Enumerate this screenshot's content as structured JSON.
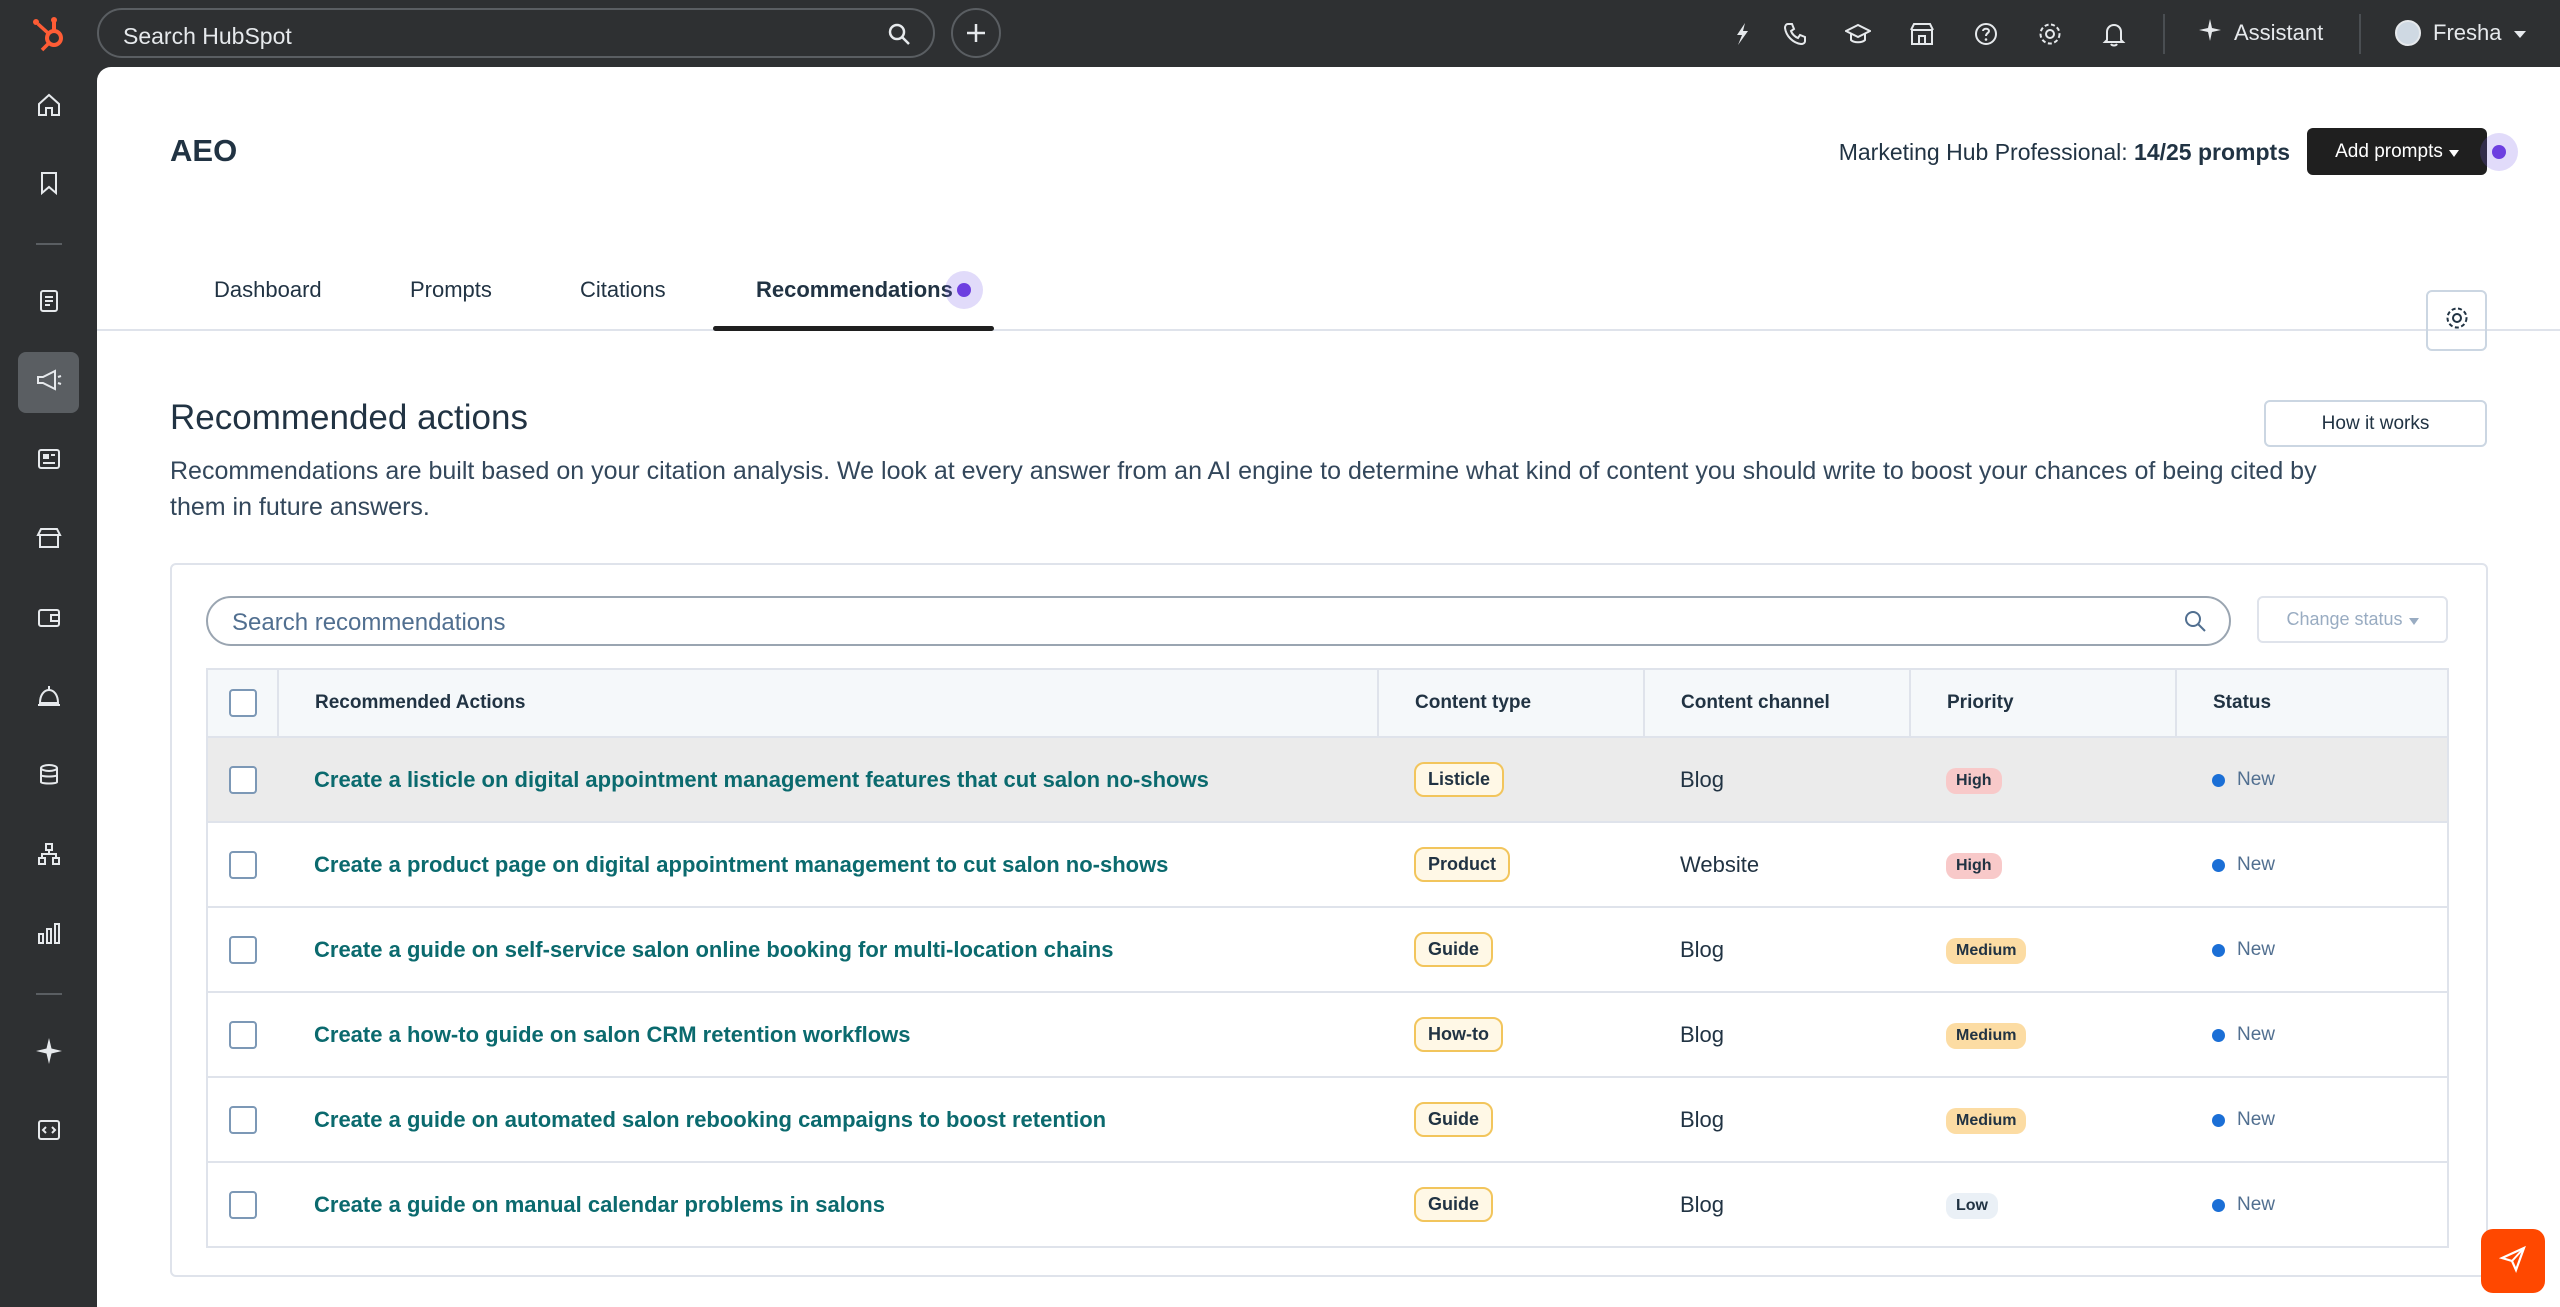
{
  "topbar": {
    "search_placeholder": "Search HubSpot",
    "assistant_label": "Assistant",
    "account_name": "Fresha",
    "icons": [
      "hubspot-logo-icon",
      "search-icon",
      "plus-icon",
      "sparkle-icon",
      "phone-icon",
      "graduation-cap-icon",
      "marketplace-icon",
      "help-icon",
      "settings-icon",
      "notifications-icon",
      "assistant-sparkle-icon",
      "chevron-down-icon"
    ]
  },
  "leftnav": {
    "items": [
      "home-icon",
      "bookmark-icon",
      "contacts-icon",
      "marketing-icon",
      "content-icon",
      "commerce-icon",
      "wallet-icon",
      "service-icon",
      "data-icon",
      "automation-icon",
      "reporting-icon",
      "ai-sparkle-icon",
      "developer-icon"
    ]
  },
  "page": {
    "title": "AEO",
    "plan_prefix": "Marketing Hub Professional:",
    "plan_usage": "14/25 prompts",
    "add_prompts_label": "Add prompts",
    "tabs": [
      "Dashboard",
      "Prompts",
      "Citations",
      "Recommendations"
    ],
    "active_tab": "Recommendations"
  },
  "section": {
    "title": "Recommended actions",
    "how_it_works_label": "How it works",
    "description": "Recommendations are built based on your citation analysis. We look at every answer from an AI engine to determine what kind of content you should write to boost your chances of being cited by them in future answers."
  },
  "table": {
    "search_placeholder": "Search recommendations",
    "change_status_label": "Change status",
    "headers": [
      "Recommended Actions",
      "Content type",
      "Content channel",
      "Priority",
      "Status"
    ],
    "rows": [
      {
        "action": "Create a listicle on digital appointment management features that cut salon no-shows",
        "type": "Listicle",
        "channel": "Blog",
        "priority": "High",
        "status": "New"
      },
      {
        "action": "Create a product page on digital appointment management to cut salon no-shows",
        "type": "Product",
        "channel": "Website",
        "priority": "High",
        "status": "New"
      },
      {
        "action": "Create a guide on self-service salon online booking for multi-location chains",
        "type": "Guide",
        "channel": "Blog",
        "priority": "Medium",
        "status": "New"
      },
      {
        "action": "Create a how-to guide on salon CRM retention workflows",
        "type": "How-to",
        "channel": "Blog",
        "priority": "Medium",
        "status": "New"
      },
      {
        "action": "Create a guide on automated salon rebooking campaigns to boost retention",
        "type": "Guide",
        "channel": "Blog",
        "priority": "Medium",
        "status": "New"
      },
      {
        "action": "Create a guide on manual calendar problems in salons",
        "type": "Guide",
        "channel": "Blog",
        "priority": "Low",
        "status": "New"
      }
    ]
  },
  "colors": {
    "accent_link": "#0b6a6e",
    "brand_orange": "#ff4800",
    "status_new": "#1b6fd6",
    "priority_high": "#f8c9c9",
    "priority_medium": "#fcdca3",
    "priority_low": "#eaf0f6"
  }
}
